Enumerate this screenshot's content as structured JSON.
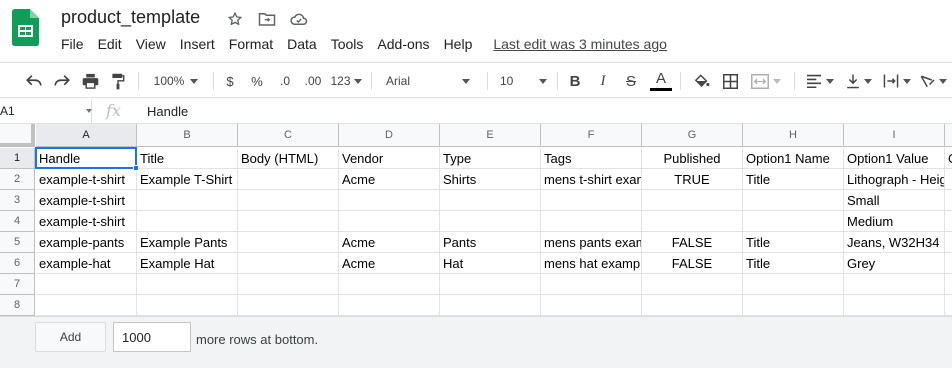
{
  "app": {
    "title": "product_template",
    "last_edit": "Last edit was 3 minutes ago",
    "brand_color": "#0F9D58"
  },
  "menu": [
    "File",
    "Edit",
    "View",
    "Insert",
    "Format",
    "Data",
    "Tools",
    "Add-ons",
    "Help"
  ],
  "toolbar": {
    "zoom": "100%",
    "currency": "$",
    "percent": "%",
    "decrease_decimal": ".0",
    "increase_decimal": ".00",
    "more_formats": "123",
    "font": "Arial",
    "font_size": "10",
    "bold": "B",
    "italic": "I",
    "strike": "S",
    "text_color_letter": "A",
    "icons": [
      "undo-icon",
      "redo-icon",
      "print-icon",
      "paint-format-icon",
      "fill-color-icon",
      "borders-icon",
      "merge-cells-icon",
      "horizontal-align-icon",
      "vertical-align-icon",
      "text-wrap-icon",
      "text-rotation-icon"
    ]
  },
  "formula_bar": {
    "cell_ref": "A1",
    "fx": "fx",
    "content": "Handle"
  },
  "grid": {
    "column_letters": [
      "A",
      "B",
      "C",
      "D",
      "E",
      "F",
      "G",
      "H",
      "I",
      ""
    ],
    "row_numbers": [
      "1",
      "2",
      "3",
      "4",
      "5",
      "6",
      "7",
      "8"
    ],
    "rows": [
      [
        "Handle",
        "Title",
        "Body (HTML)",
        "Vendor",
        "Type",
        "Tags",
        "Published",
        "Option1 Name",
        "Option1 Value",
        "O"
      ],
      [
        "example-t-shirt",
        "Example T-Shirt",
        "",
        "Acme",
        "Shirts",
        "mens t-shirt example",
        "TRUE",
        "Title",
        "Lithograph - Height",
        ""
      ],
      [
        "example-t-shirt",
        "",
        "",
        "",
        "",
        "",
        "",
        "",
        "Small",
        ""
      ],
      [
        "example-t-shirt",
        "",
        "",
        "",
        "",
        "",
        "",
        "",
        "Medium",
        ""
      ],
      [
        "example-pants",
        "Example Pants",
        "",
        "Acme",
        "Pants",
        "mens pants example",
        "FALSE",
        "Title",
        "Jeans, W32H34",
        ""
      ],
      [
        "example-hat",
        "Example Hat",
        "",
        "Acme",
        "Hat",
        "mens hat example",
        "FALSE",
        "Title",
        "Grey",
        ""
      ],
      [
        "",
        "",
        "",
        "",
        "",
        "",
        "",
        "",
        "",
        ""
      ],
      [
        "",
        "",
        "",
        "",
        "",
        "",
        "",
        "",
        "",
        ""
      ]
    ],
    "centered_columns": [
      6
    ],
    "selected_cell": "A1",
    "selection_color": "#1a73e8"
  },
  "footer": {
    "add_label": "Add",
    "rows_value": "1000",
    "suffix_text": "more rows at bottom."
  }
}
